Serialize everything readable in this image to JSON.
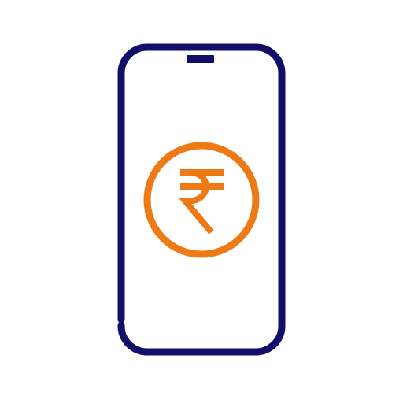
{
  "icon": {
    "name": "mobile-payment-rupee-icon",
    "symbol": "rupee-currency-symbol",
    "colors": {
      "phone_outline": "#120f6b",
      "rupee_accent": "#ee7a16",
      "background": "#ffffff"
    }
  }
}
